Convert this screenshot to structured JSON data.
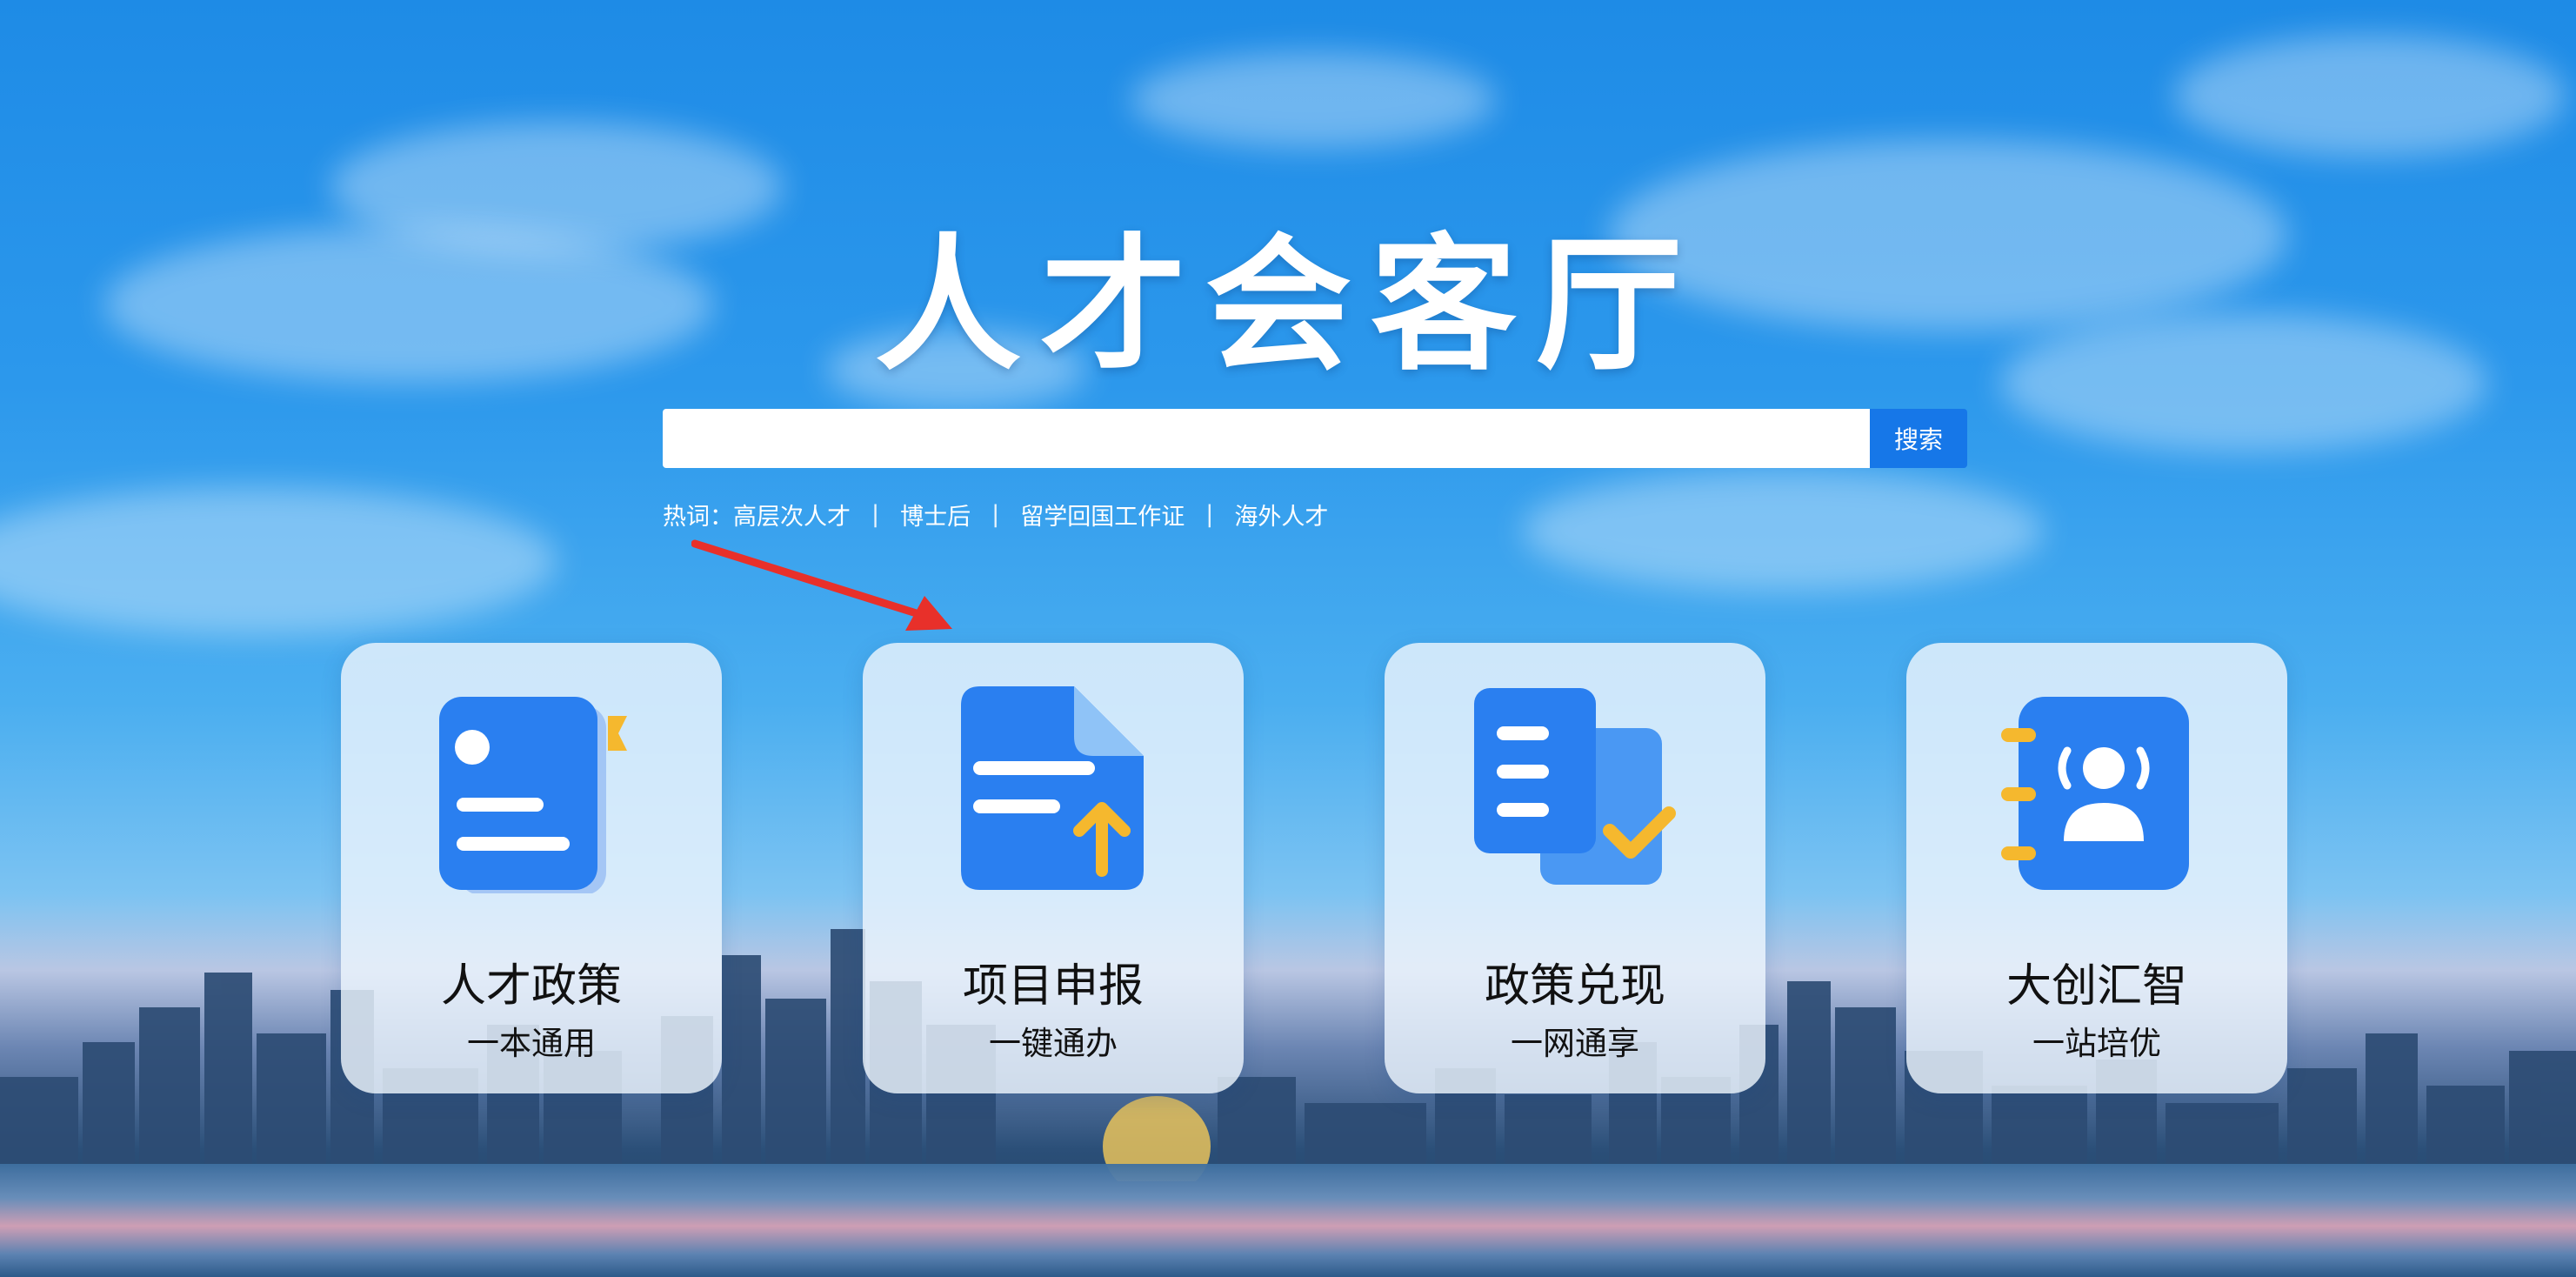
{
  "page": {
    "title": "人才会客厅"
  },
  "search": {
    "placeholder": "",
    "button_label": "搜索"
  },
  "hotwords": {
    "label": "热词：",
    "items": [
      "高层次人才",
      "博士后",
      "留学回国工作证",
      "海外人才"
    ],
    "separator": "|"
  },
  "cards": [
    {
      "title": "人才政策",
      "subtitle": "一本通用",
      "icon": "policy-document-icon"
    },
    {
      "title": "项目申报",
      "subtitle": "一键通办",
      "icon": "file-upload-icon"
    },
    {
      "title": "政策兑现",
      "subtitle": "一网通享",
      "icon": "document-check-icon"
    },
    {
      "title": "大创汇智",
      "subtitle": "一站培优",
      "icon": "contact-book-icon"
    }
  ],
  "colors": {
    "accent": "#1677e8",
    "icon_blue": "#2a7ff0",
    "icon_yellow": "#f5b82e",
    "arrow": "#e8302a"
  }
}
